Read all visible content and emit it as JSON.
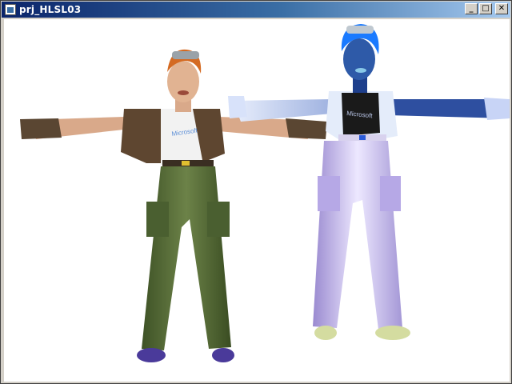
{
  "window": {
    "title": "prj_HLSL03",
    "controls": {
      "minimize": "_",
      "maximize": "□",
      "close": "✕"
    }
  },
  "viewport": {
    "background": "#ffffff",
    "models": [
      {
        "name": "textured-character",
        "shirt_logo": "Microsoft"
      },
      {
        "name": "shaded-character",
        "shirt_logo": "Microsoft"
      }
    ]
  },
  "colors": {
    "title_start": "#0a246a",
    "title_end": "#a6caf0",
    "pants_left": "#556b3a",
    "pants_right": "#c8bce8",
    "skin_right": "#2e5aa8"
  },
  "icons": [
    "app-window-icon",
    "minimize-icon",
    "maximize-icon",
    "close-icon"
  ]
}
